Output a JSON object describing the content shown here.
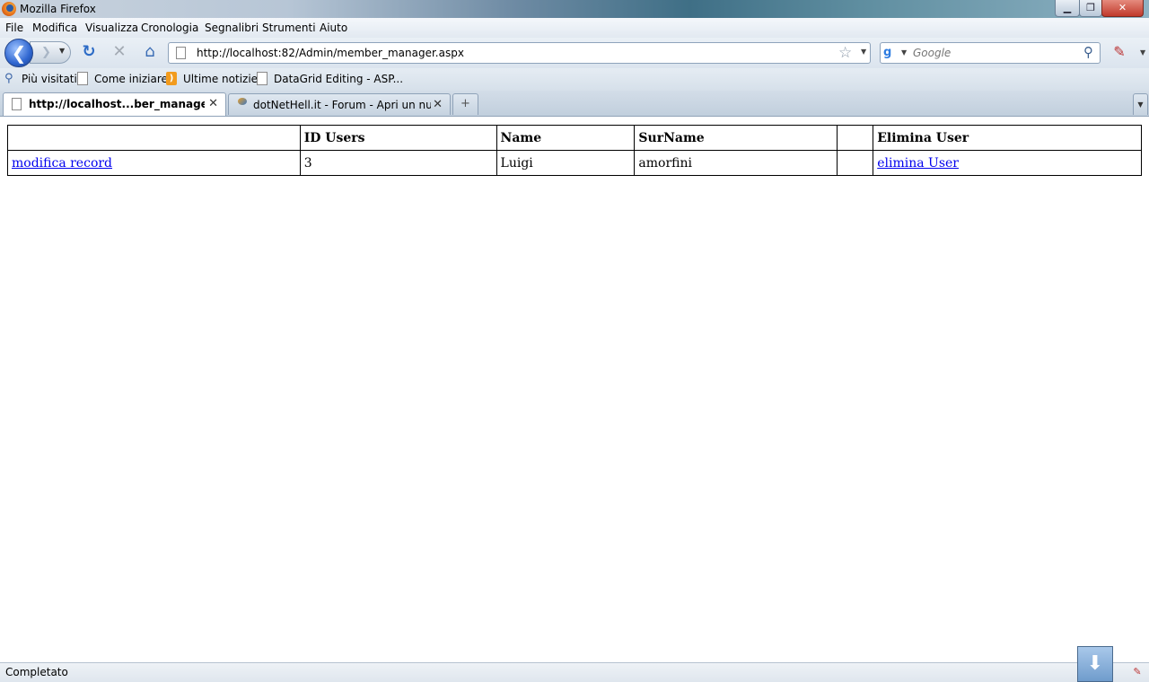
{
  "window": {
    "title": "Mozilla Firefox",
    "min_glyph": "▁",
    "max_glyph": "❐",
    "close_glyph": "✕"
  },
  "menu": [
    "File",
    "Modifica",
    "Visualizza",
    "Cronologia",
    "Segnalibri",
    "Strumenti",
    "Aiuto"
  ],
  "nav": {
    "url": "http://localhost:82/Admin/member_manager.aspx",
    "search_placeholder": "Google",
    "back_glyph": "❮",
    "forward_glyph": "❯",
    "reload_glyph": "↻",
    "stop_glyph": "✕",
    "home_glyph": "⌂",
    "star_glyph": "☆",
    "search_glyph": "⚲",
    "google_glyph": "g",
    "drop_glyph": "▼"
  },
  "bookmarks": [
    "Più visitati",
    "Come iniziare",
    "Ultime notizie",
    "DataGrid Editing - ASP..."
  ],
  "tabs": [
    {
      "label": "http://localhost...ber_manager.aspx",
      "active": true
    },
    {
      "label": "dotNetHell.it - Forum - Apri un nuo...",
      "active": false
    }
  ],
  "tab_ui": {
    "close_glyph": "✕",
    "new_tab_glyph": "+",
    "list_glyph": "▼"
  },
  "grid": {
    "headers": [
      "",
      "ID Users",
      "Name",
      "SurName",
      "",
      "Elimina User"
    ],
    "rows": [
      {
        "edit_link": "modifica record",
        "id": "3",
        "name": "Luigi",
        "surname": "amorfini",
        "blank": "",
        "delete_link": "elimina User"
      }
    ]
  },
  "status": {
    "text": "Completato"
  },
  "icons": {
    "firefox": "firefox-logo-icon",
    "page": "page-icon",
    "rss": "rss-icon",
    "most_visited": "most-visited-icon",
    "downloads": "download-arrow-icon",
    "pen": "web-clip-pen-icon"
  }
}
